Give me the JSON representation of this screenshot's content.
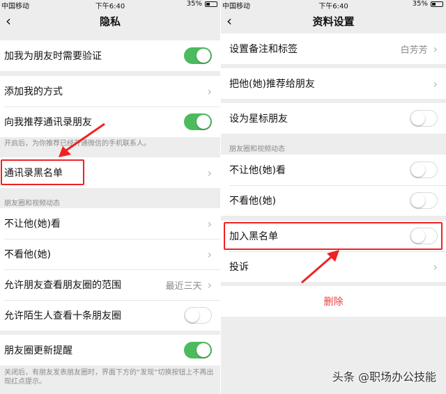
{
  "status": {
    "carrier": "中国移动",
    "time": "下午6:40",
    "battery": "35%"
  },
  "left": {
    "title": "隐私",
    "rows": {
      "verify": "加我为朋友时需要验证",
      "add_methods": "添加我的方式",
      "recommend": "向我推荐通讯录朋友",
      "recommend_note": "开启后，为你推荐已经开通微信的手机联系人。",
      "blacklist": "通讯录黑名单",
      "section_moments": "朋友圈和视频动态",
      "hide_my": "不让他(她)看",
      "hide_their": "不看他(她)",
      "range": "允许朋友查看朋友圈的范围",
      "range_value": "最近三天",
      "stranger": "允许陌生人查看十条朋友圈",
      "update_remind": "朋友圈更新提醒",
      "update_note": "关闭后，有朋友发表朋友圈时，界面下方的“发现”切换按钮上不再出现红点提示。"
    },
    "toggles": {
      "verify": true,
      "recommend": true,
      "stranger": false,
      "update_remind": true
    }
  },
  "right": {
    "title": "资料设置",
    "rows": {
      "remark": "设置备注和标签",
      "remark_value": "白芳芳",
      "recommend_friend": "把他(她)推荐给朋友",
      "star": "设为星标朋友",
      "section_moments": "朋友圈和视频动态",
      "hide_my": "不让他(她)看",
      "hide_their": "不看他(她)",
      "block": "加入黑名单",
      "complain": "投诉",
      "delete": "删除"
    },
    "toggles": {
      "star": false,
      "hide_my": false,
      "hide_their": false,
      "block": false
    }
  },
  "watermark": "头条 @职场办公技能",
  "colors": {
    "toggle_on": "#4cbb5e",
    "highlight": "#ee2222",
    "delete_text": "#e64340"
  }
}
